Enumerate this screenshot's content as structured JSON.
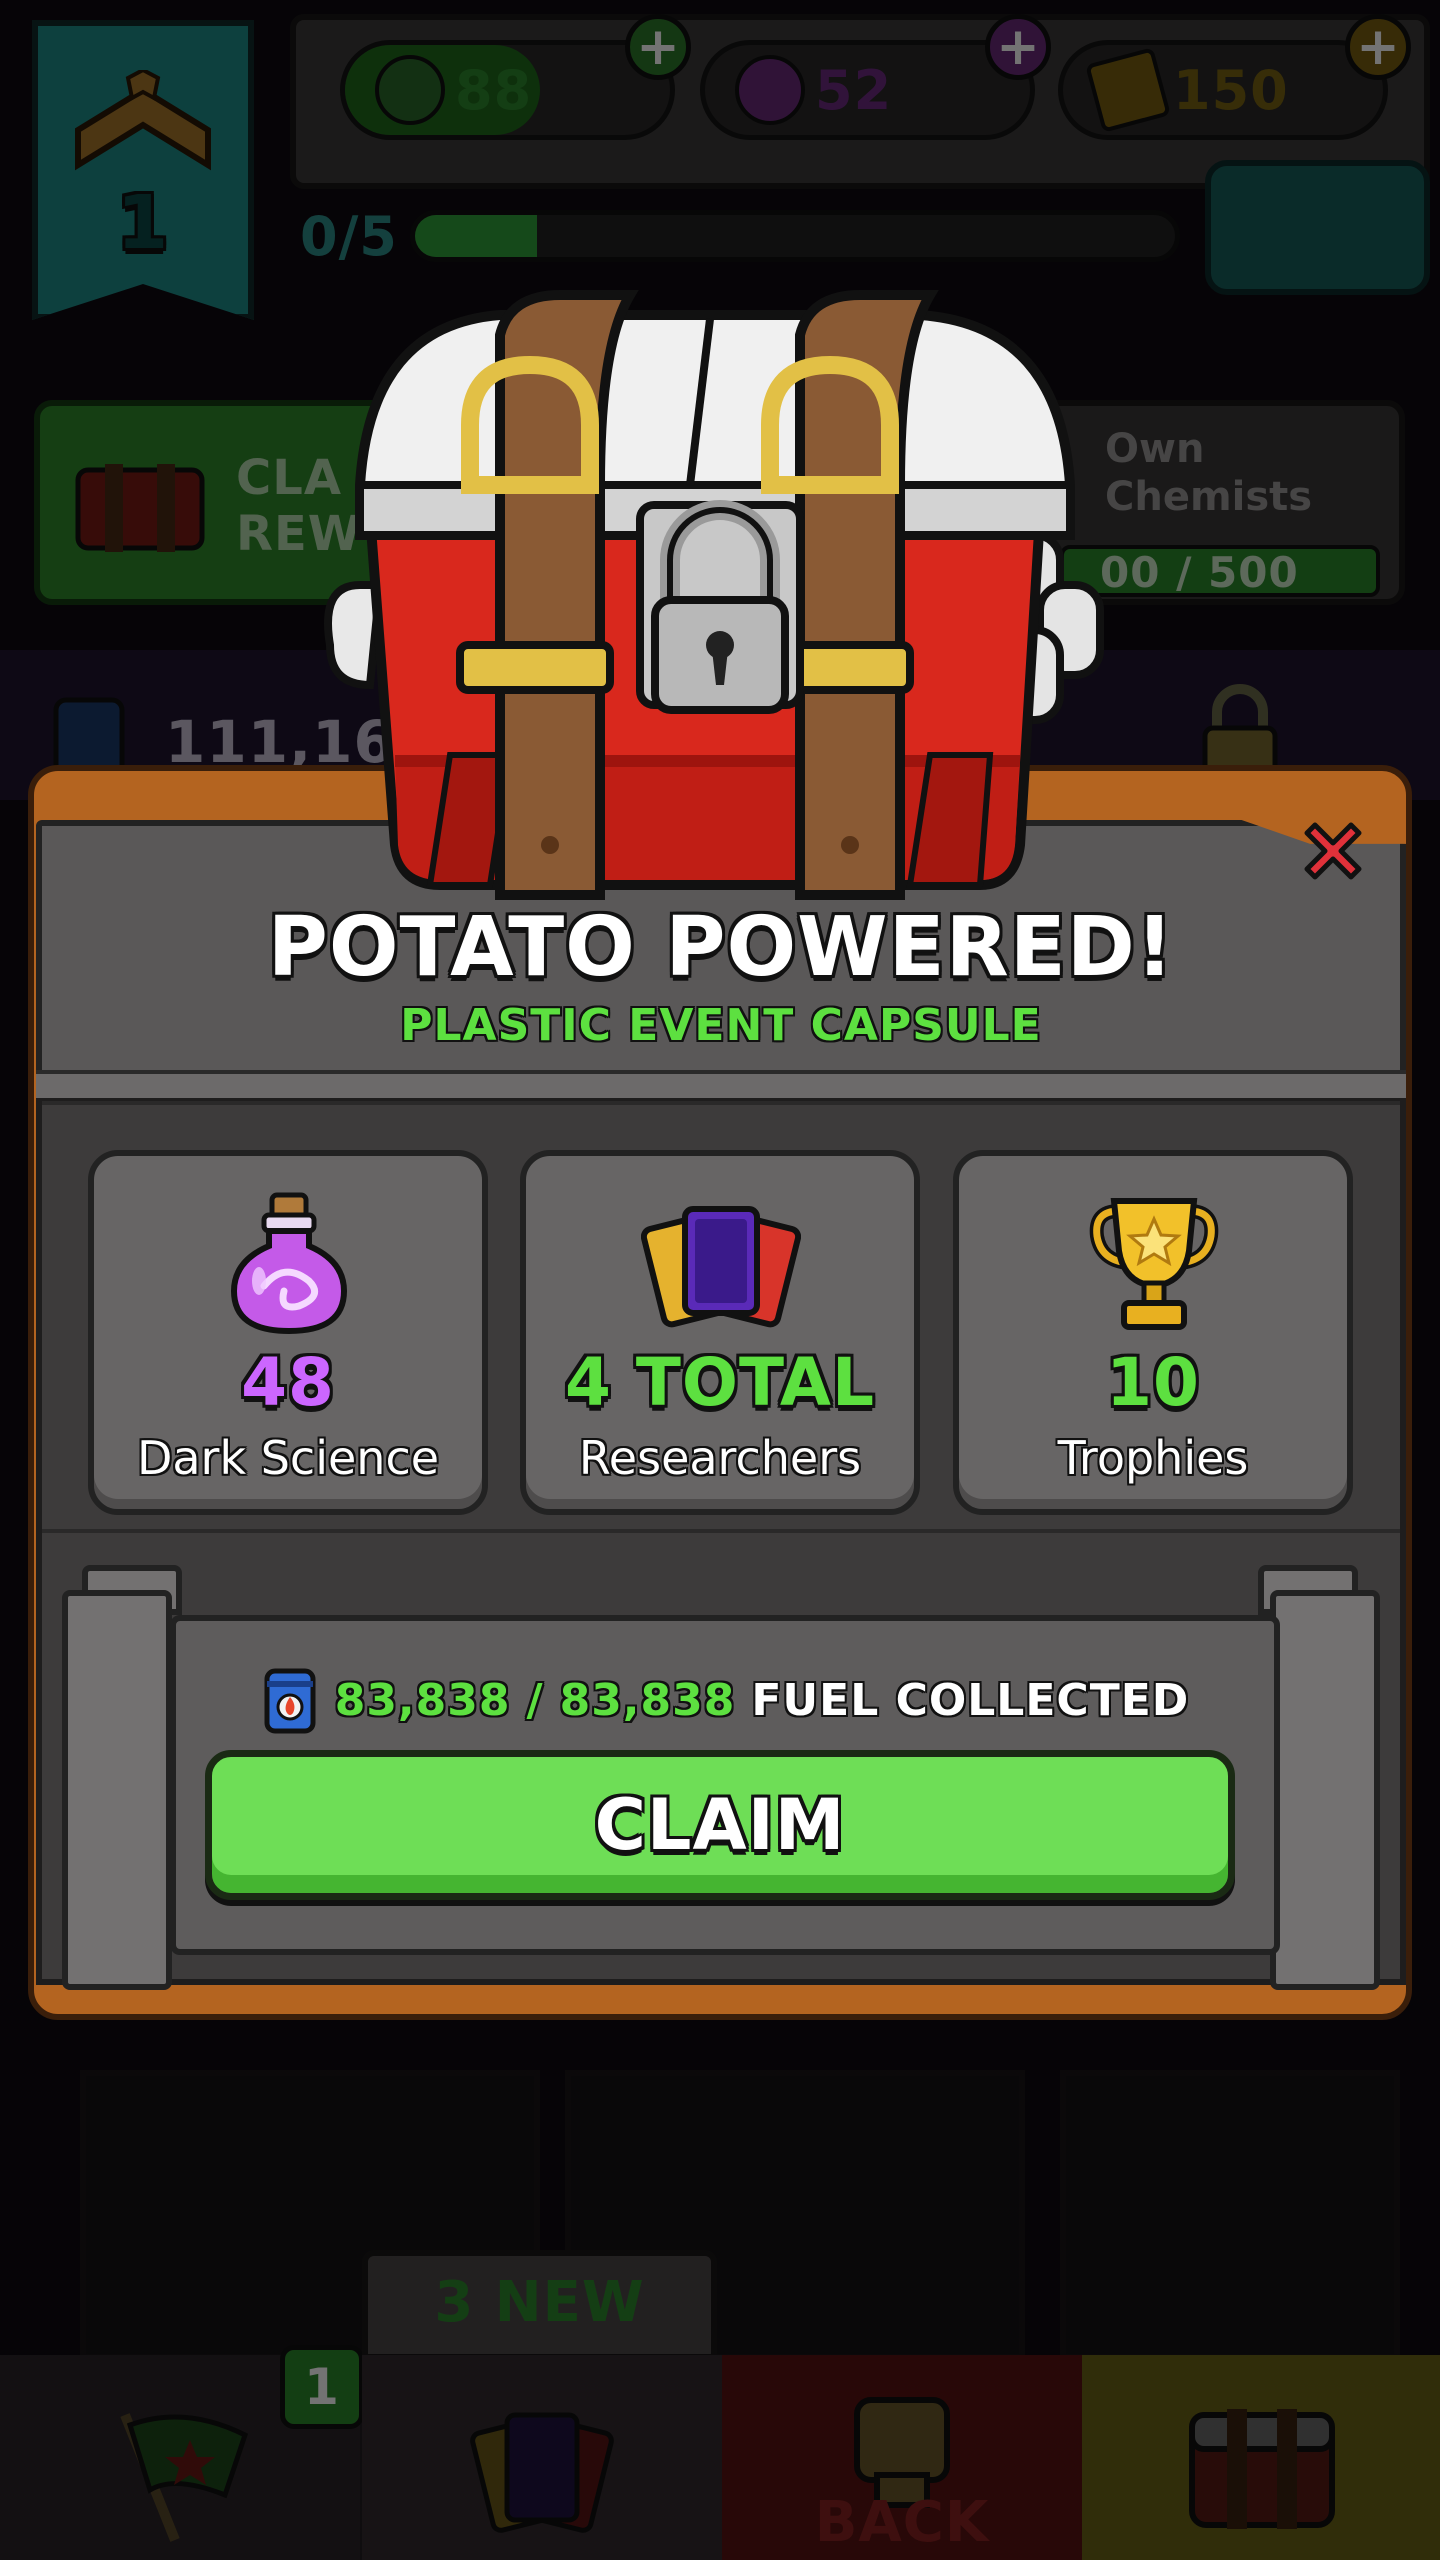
{
  "background": {
    "rank_level": "1",
    "currencies": {
      "fuel": "88",
      "dark_science": "52",
      "gold": "150"
    },
    "xp_progress_label": "0/5",
    "claim_rewards_label": [
      "CLA",
      "REW"
    ],
    "own_chemists": {
      "label_line1": "Own",
      "label_line2": "Chemists",
      "progress": "00 / 500"
    },
    "fuel_amount_partial": "111,166",
    "bottom_nav": {
      "new_tab_label": "3 NEW",
      "flag_badge_count": "1",
      "back_label": "BACK"
    }
  },
  "modal": {
    "title": "POTATO POWERED!",
    "subtitle": "PLASTIC EVENT CAPSULE",
    "rewards": [
      {
        "amount": "48",
        "label": "Dark Science",
        "icon": "dark-science-potion-icon",
        "color": "#cc66ff"
      },
      {
        "amount": "4 TOTAL",
        "label": "Researchers",
        "icon": "researcher-cards-icon",
        "color": "#5de040"
      },
      {
        "amount": "10",
        "label": "Trophies",
        "icon": "trophy-icon",
        "color": "#5de040"
      }
    ],
    "fuel_collected": {
      "current": "83,838",
      "separator": "/",
      "max": "83,838",
      "suffix": "FUEL COLLECTED"
    },
    "claim_label": "CLAIM"
  },
  "colors": {
    "accent_green": "#5de040",
    "dark_science_purple": "#cc66ff",
    "frame_orange": "#b46420",
    "claim_button": "#6ede56"
  }
}
